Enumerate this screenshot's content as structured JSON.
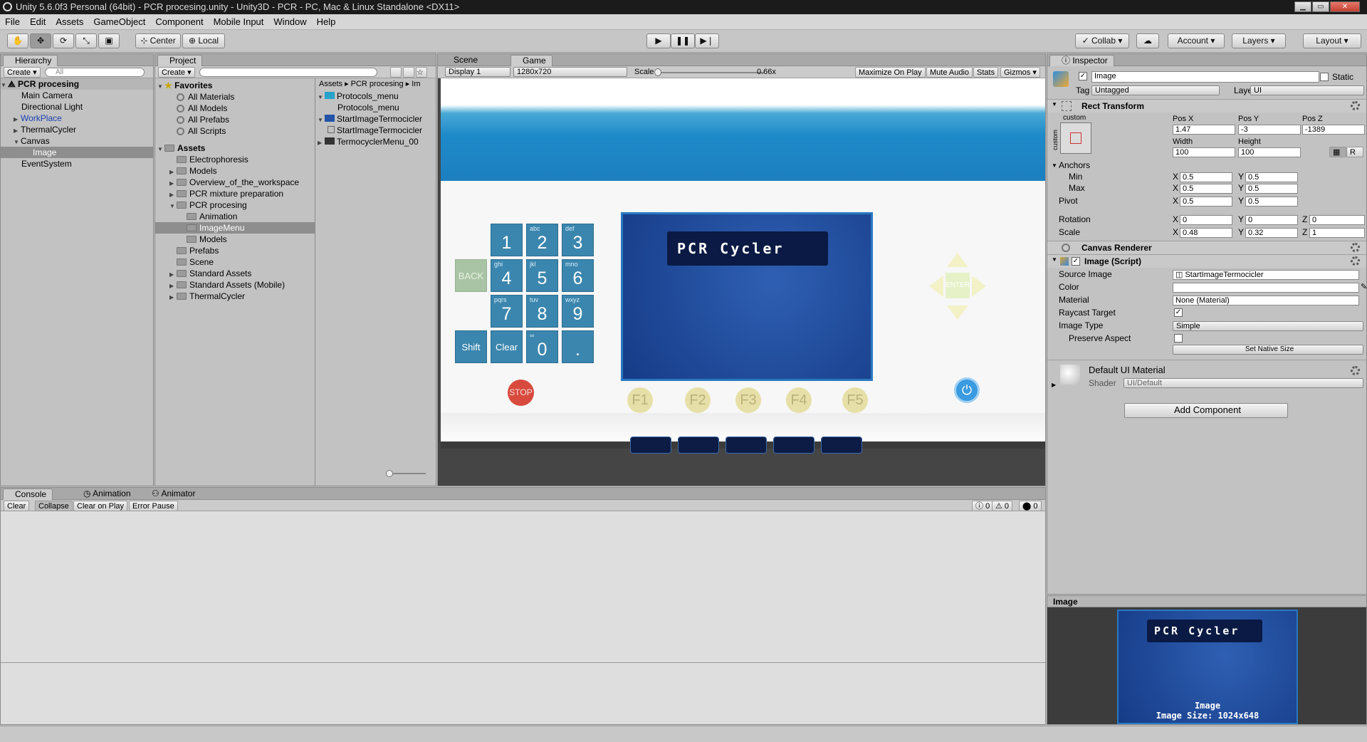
{
  "window": {
    "title": "Unity 5.6.0f3 Personal (64bit) - PCR procesing.unity - Unity3D - PCR - PC, Mac & Linux Standalone <DX11>"
  },
  "menu": [
    "File",
    "Edit",
    "Assets",
    "GameObject",
    "Component",
    "Mobile Input",
    "Window",
    "Help"
  ],
  "toolbar": {
    "center": "Center",
    "local": "Local",
    "collab": "Collab",
    "account": "Account",
    "layers": "Layers",
    "layout": "Layout"
  },
  "hierarchy": {
    "tab": "Hierarchy",
    "create": "Create",
    "search_placeholder": "All",
    "scene": "PCR procesing",
    "items": [
      "Main Camera",
      "Directional Light",
      "WorkPlace",
      "ThermalCycler",
      "Canvas",
      "Image",
      "EventSystem"
    ]
  },
  "project": {
    "tab": "Project",
    "create": "Create",
    "favorites_label": "Favorites",
    "favorites": [
      "All Materials",
      "All Models",
      "All Prefabs",
      "All Scripts"
    ],
    "assets_label": "Assets",
    "folders": [
      "Electrophoresis",
      "Models",
      "Overview_of_the_workspace",
      "PCR mixture preparation",
      "PCR procesing",
      "Animation",
      "ImageMenu",
      "Models",
      "Prefabs",
      "Scene",
      "Standard Assets",
      "Standard Assets (Mobile)",
      "ThermalCycler"
    ],
    "breadcrumb": [
      "Assets",
      "PCR procesing",
      "Im"
    ],
    "files": [
      "Protocols_menu",
      "Protocols_menu",
      "StartImageTermocicler",
      "StartImageTermocicler",
      "TermocyclerMenu_00"
    ]
  },
  "scene_tabs": {
    "scene": "Scene",
    "game": "Game"
  },
  "game_bar": {
    "display": "Display 1",
    "resolution": "1280x720",
    "scale_label": "Scale",
    "scale_value": "0.66x",
    "maximize": "Maximize On Play",
    "mute": "Mute Audio",
    "stats": "Stats",
    "gizmos": "Gizmos"
  },
  "device": {
    "keys": [
      {
        "label": "1",
        "sub": ""
      },
      {
        "label": "2",
        "sub": "abc"
      },
      {
        "label": "3",
        "sub": "def"
      },
      {
        "label": "4",
        "sub": "ghi"
      },
      {
        "label": "5",
        "sub": "jkl"
      },
      {
        "label": "6",
        "sub": "mno"
      },
      {
        "label": "7",
        "sub": "pqrs"
      },
      {
        "label": "8",
        "sub": "tuv"
      },
      {
        "label": "9",
        "sub": "wxyz"
      },
      {
        "label": "0",
        "sub": "∞"
      },
      {
        "label": ".",
        "sub": ""
      }
    ],
    "back": "BACK",
    "shift": "Shift",
    "clear": "Clear",
    "stop": "STOP",
    "enter": "ENTER",
    "fkeys": [
      "F1",
      "F2",
      "F3",
      "F4",
      "F5"
    ],
    "screen_title_a": "PCR",
    "screen_title_b": "Cycler"
  },
  "console": {
    "tabs": [
      "Console",
      "Animation",
      "Animator"
    ],
    "buttons": [
      "Clear",
      "Collapse",
      "Clear on Play",
      "Error Pause"
    ],
    "counts": [
      "0",
      "0",
      "0"
    ]
  },
  "inspector": {
    "tab": "Inspector",
    "name": "Image",
    "static": "Static",
    "tag_label": "Tag",
    "tag": "Untagged",
    "layer_label": "Layer",
    "layer": "UI",
    "rect_transform": "Rect Transform",
    "custom": "custom",
    "posx_label": "Pos X",
    "posy_label": "Pos Y",
    "posz_label": "Pos Z",
    "posx": "1.47",
    "posy": "-3",
    "posz": "-1389",
    "width_label": "Width",
    "height_label": "Height",
    "width": "100",
    "height": "100",
    "r": "R",
    "anchors": "Anchors",
    "min": "Min",
    "max": "Max",
    "pivot": "Pivot",
    "x": "X",
    "y": "Y",
    "z": "Z",
    "anchor_min_x": "0.5",
    "anchor_min_y": "0.5",
    "anchor_max_x": "0.5",
    "anchor_max_y": "0.5",
    "pivot_x": "0.5",
    "pivot_y": "0.5",
    "rotation": "Rotation",
    "rot_x": "0",
    "rot_y": "0",
    "rot_z": "0",
    "scale": "Scale",
    "scale_x": "0.48",
    "scale_y": "0.32",
    "scale_z": "1",
    "canvas_renderer": "Canvas Renderer",
    "image_script": "Image (Script)",
    "source_image_label": "Source Image",
    "source_image": "StartImageTermocicler",
    "color_label": "Color",
    "material_label": "Material",
    "material": "None (Material)",
    "raycast_label": "Raycast Target",
    "image_type_label": "Image Type",
    "image_type": "Simple",
    "preserve_label": "Preserve Aspect",
    "set_native": "Set Native Size",
    "default_material": "Default UI Material",
    "shader_label": "Shader",
    "shader": "UI/Default",
    "add_component": "Add Component"
  },
  "preview": {
    "title": "Image",
    "caption_a": "Image",
    "caption_b": "Image Size: 1024x648"
  }
}
